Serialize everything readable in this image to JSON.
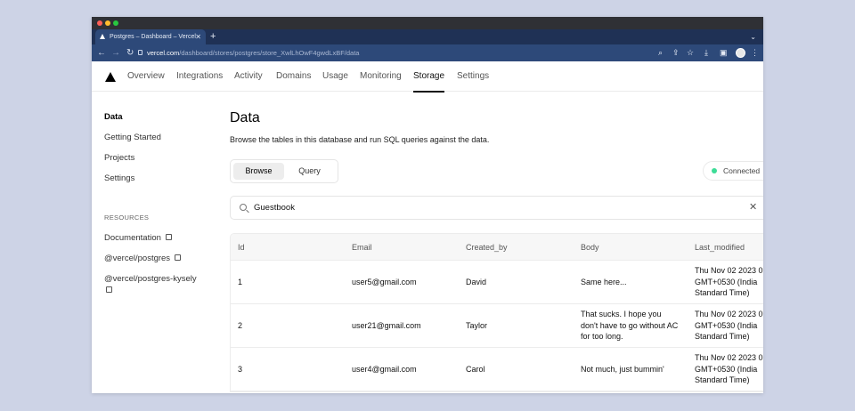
{
  "browser": {
    "tab_title": "Postgres – Dashboard – Vercel",
    "url_host": "vercel.com",
    "url_path": "/dashboard/stores/postgres/store_XwlLhOwF4gwdLxBF/data"
  },
  "nav": {
    "items": [
      "Overview",
      "Integrations",
      "Activity",
      "Domains",
      "Usage",
      "Monitoring",
      "Storage",
      "Settings"
    ],
    "active": "Storage"
  },
  "sidebar": {
    "items": [
      "Data",
      "Getting Started",
      "Projects",
      "Settings"
    ],
    "resources_heading": "RESOURCES",
    "resources": [
      "Documentation",
      "@vercel/postgres",
      "@vercel/postgres-kysely"
    ]
  },
  "main": {
    "title": "Data",
    "description": "Browse the tables in this database and run SQL queries against the data.",
    "tabs": [
      "Browse",
      "Query"
    ],
    "status": "Connected",
    "search_value": "Guestbook"
  },
  "table": {
    "columns": [
      "Id",
      "Email",
      "Created_by",
      "Body",
      "Last_modified"
    ],
    "rows": [
      [
        "1",
        "user5@gmail.com",
        "David",
        "Same here...",
        "Thu Nov 02 2023 0\nGMT+0530 (India\nStandard Time)"
      ],
      [
        "2",
        "user21@gmail.com",
        "Taylor",
        "That sucks. I hope you don't have to go without AC for too long.",
        "Thu Nov 02 2023 0\nGMT+0530 (India\nStandard Time)"
      ],
      [
        "3",
        "user4@gmail.com",
        "Carol",
        "Not much, just bummin'",
        "Thu Nov 02 2023 0\nGMT+0530 (India\nStandard Time)"
      ]
    ]
  },
  "colors": {
    "tabbar": "#1f3155",
    "addressbar": "#2d4979",
    "status_dot": "#3ddc97"
  }
}
